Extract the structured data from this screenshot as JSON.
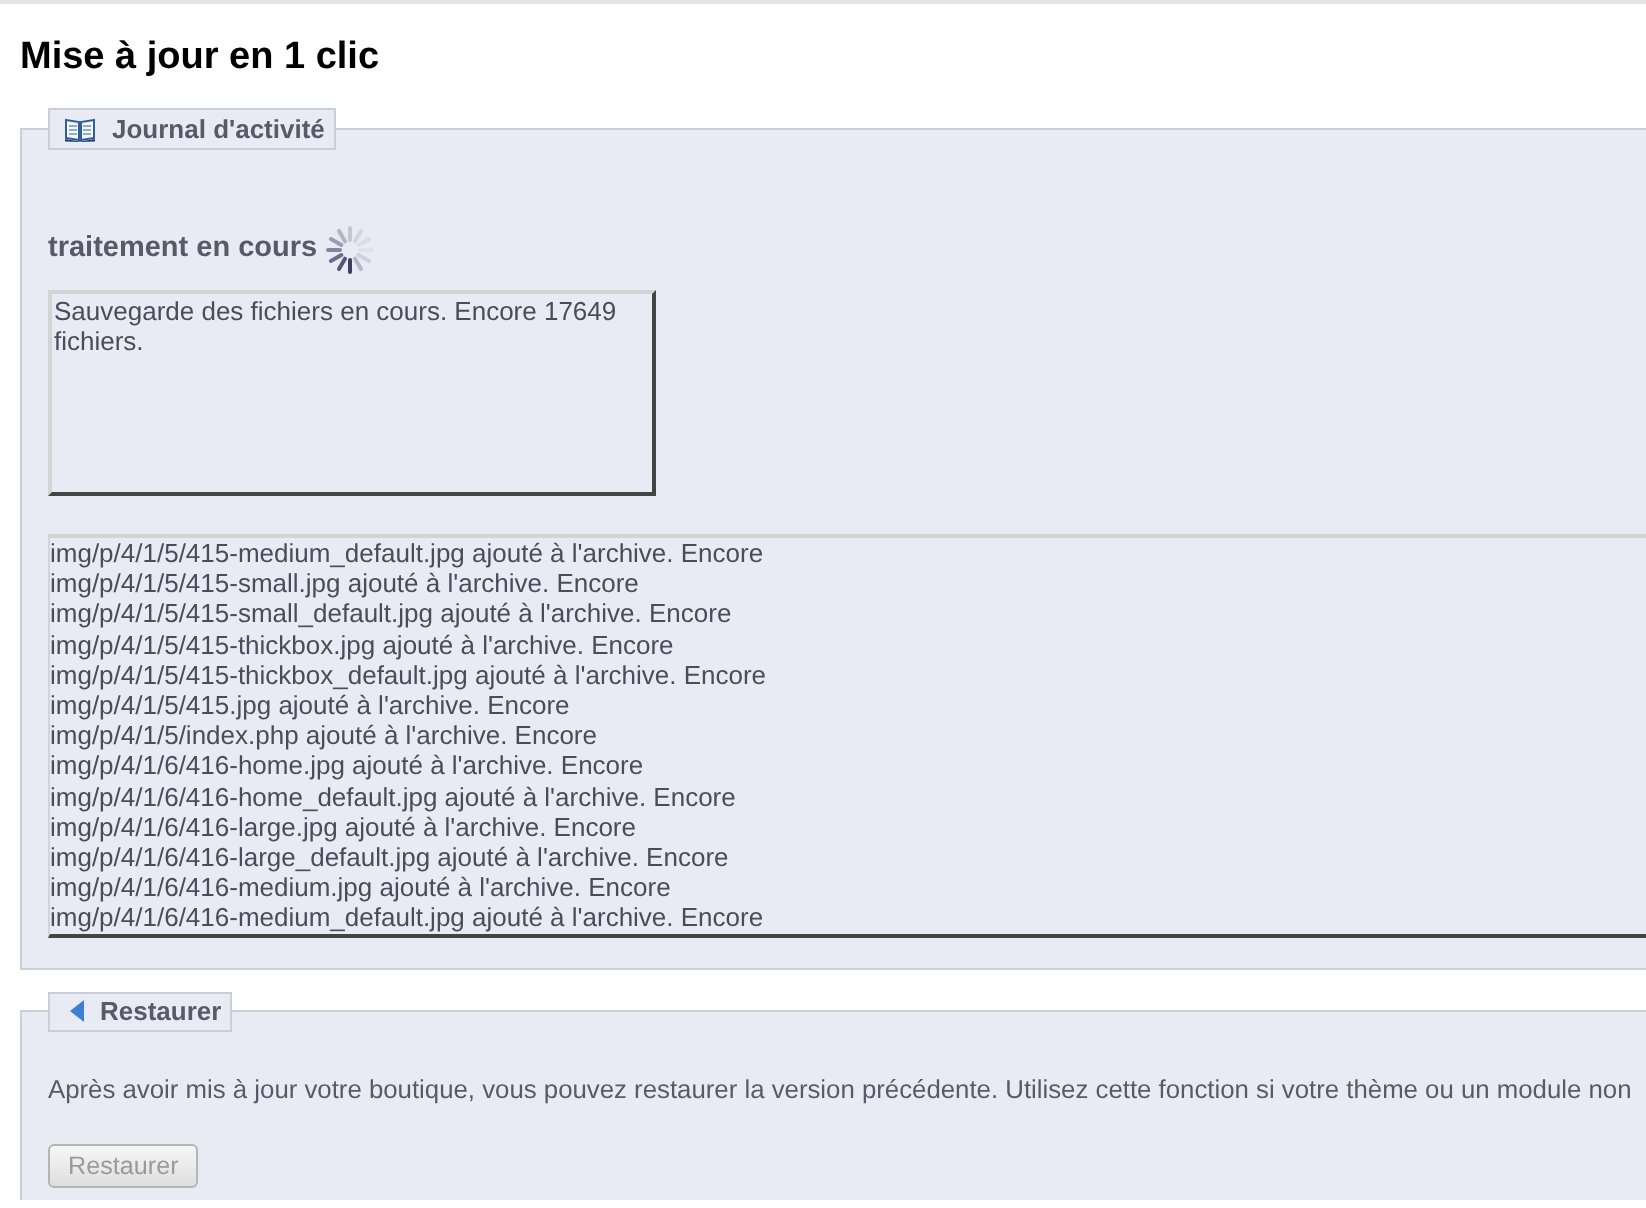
{
  "page": {
    "title": "Mise à jour en 1 clic"
  },
  "activity_log": {
    "legend": "Journal d'activité",
    "status_heading": "traitement en cours",
    "busy": true,
    "status_message": "Sauvegarde des fichiers en cours. Encore 17649 fichiers.",
    "log_lines": [
      "img/p/4/1/5/415-medium_default.jpg ajouté à l'archive. Encore",
      "img/p/4/1/5/415-small.jpg ajouté à l'archive. Encore",
      "img/p/4/1/5/415-small_default.jpg ajouté à l'archive. Encore",
      "img/p/4/1/5/415-thickbox.jpg ajouté à l'archive. Encore",
      "img/p/4/1/5/415-thickbox_default.jpg ajouté à l'archive. Encore",
      "img/p/4/1/5/415.jpg ajouté à l'archive. Encore",
      "img/p/4/1/5/index.php ajouté à l'archive. Encore",
      "img/p/4/1/6/416-home.jpg ajouté à l'archive. Encore",
      "img/p/4/1/6/416-home_default.jpg ajouté à l'archive. Encore",
      "img/p/4/1/6/416-large.jpg ajouté à l'archive. Encore",
      "img/p/4/1/6/416-large_default.jpg ajouté à l'archive. Encore",
      "img/p/4/1/6/416-medium.jpg ajouté à l'archive. Encore",
      "img/p/4/1/6/416-medium_default.jpg ajouté à l'archive. Encore"
    ]
  },
  "restore": {
    "legend": "Restaurer",
    "description": "Après avoir mis à jour votre boutique, vous pouvez restaurer la version précédente. Utilisez cette fonction si votre thème ou un module non",
    "button": {
      "label": "Restaurer",
      "disabled": true
    }
  }
}
